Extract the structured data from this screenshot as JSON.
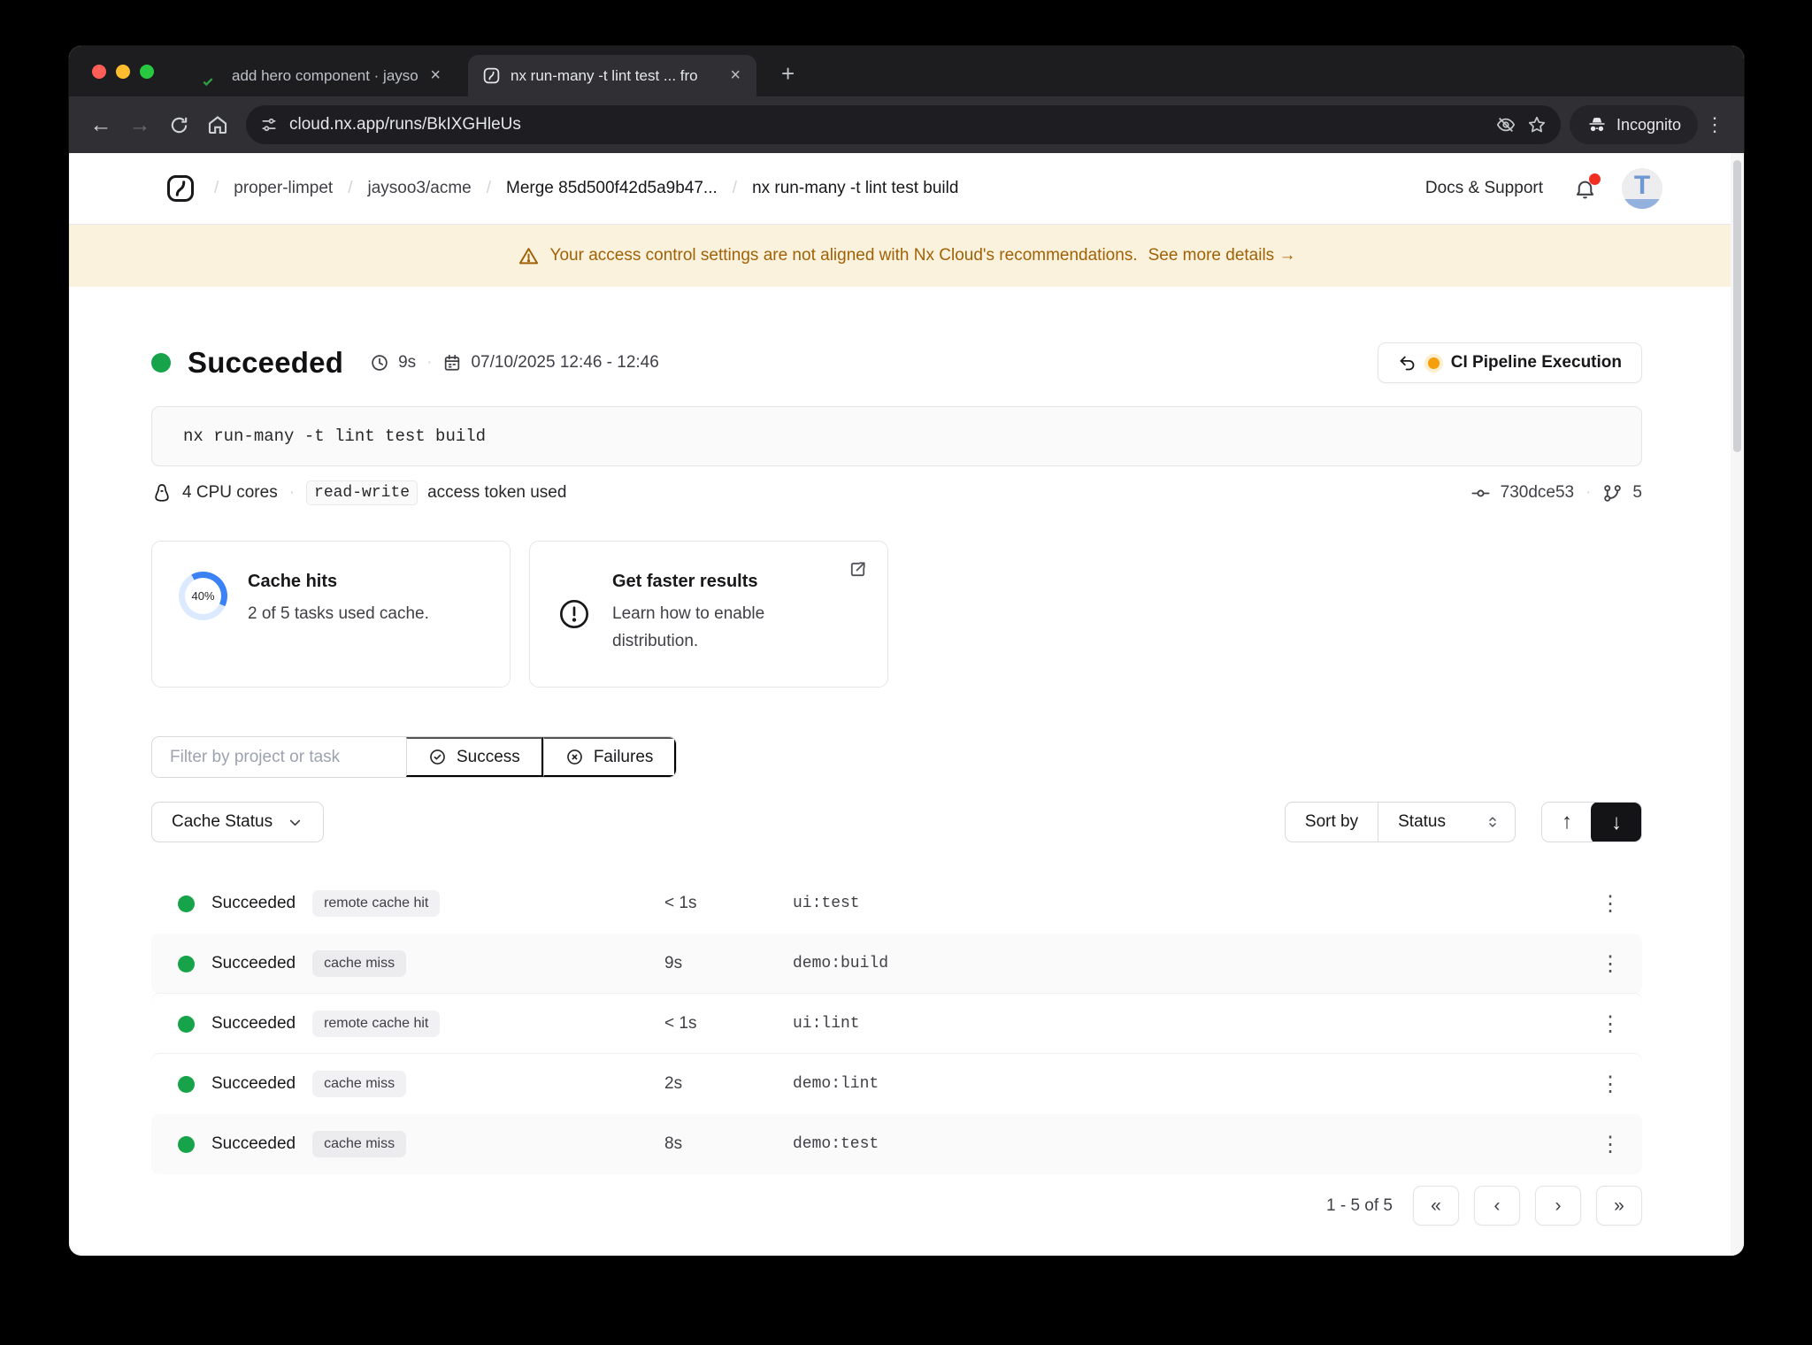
{
  "browser": {
    "tabs": [
      {
        "title": "add hero component · jaysoo"
      },
      {
        "title": "nx run-many -t lint test ... fro"
      }
    ],
    "close_glyph": "×",
    "new_tab_glyph": "+",
    "back_glyph": "←",
    "forward_glyph": "→",
    "url": "cloud.nx.app/runs/BkIXGHleUs",
    "incognito_label": "Incognito",
    "kebab_glyph": "⋮"
  },
  "header": {
    "breadcrumb": [
      "proper-limpet",
      "jaysoo3/acme",
      "Merge 85d500f42d5a9b47...",
      "nx run-many -t lint test build"
    ],
    "separator": "/",
    "docs_support": "Docs & Support",
    "avatar_initial": "T"
  },
  "banner": {
    "message": "Your access control settings are not aligned with Nx Cloud's recommendations.",
    "link": "See more details →"
  },
  "run": {
    "status": "Succeeded",
    "duration": "9s",
    "date_range": "07/10/2025 12:46 - 12:46",
    "pipeline_button": "CI Pipeline Execution",
    "command": "nx run-many -t lint test build",
    "cpu": "4 CPU cores",
    "token_badge": "read-write",
    "token_suffix": "access token used",
    "commit": "730dce53",
    "branch_count": "5",
    "dot": "·"
  },
  "cards": {
    "cache_hits": {
      "title": "Cache hits",
      "description": "2 of 5 tasks used cache.",
      "percent": 40,
      "percent_label": "40%",
      "arc_color": "#3b82f6",
      "track_color": "#dbeafe"
    },
    "distribution": {
      "title": "Get faster results",
      "description": "Learn how to enable distribution."
    }
  },
  "filters": {
    "placeholder": "Filter by project or task",
    "success": "Success",
    "failures": "Failures"
  },
  "controls": {
    "cache_status": "Cache Status",
    "sort_by": "Sort by",
    "sort_value": "Status",
    "asc_glyph": "↑",
    "desc_glyph": "↓"
  },
  "table": {
    "kebab_glyph": "⋮",
    "rows": [
      {
        "status": "Succeeded",
        "badge": "remote cache hit",
        "duration": "< 1s",
        "task": "ui:test"
      },
      {
        "status": "Succeeded",
        "badge": "cache miss",
        "duration": "9s",
        "task": "demo:build"
      },
      {
        "status": "Succeeded",
        "badge": "remote cache hit",
        "duration": "< 1s",
        "task": "ui:lint"
      },
      {
        "status": "Succeeded",
        "badge": "cache miss",
        "duration": "2s",
        "task": "demo:lint"
      },
      {
        "status": "Succeeded",
        "badge": "cache miss",
        "duration": "8s",
        "task": "demo:test"
      }
    ]
  },
  "pagination": {
    "label": "1 - 5 of 5",
    "first": "«",
    "prev": "‹",
    "next": "›",
    "last": "»"
  },
  "colors": {
    "success_green": "#16a34a",
    "warning_amber": "#a16207",
    "accent_blue": "#3b82f6",
    "pending_orange": "#f59e0b"
  }
}
